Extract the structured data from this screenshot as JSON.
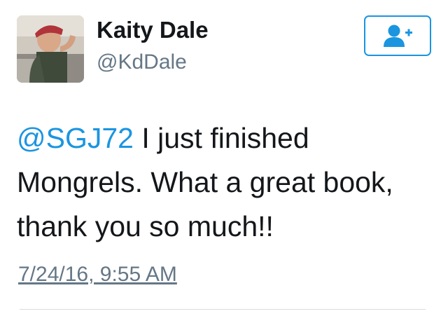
{
  "user": {
    "display_name": "Kaity Dale",
    "handle": "@KdDale",
    "avatar_icon": "profile-photo"
  },
  "follow_button": {
    "icon": "follow-user-plus-icon",
    "accent_color": "#1b95e0"
  },
  "tweet": {
    "mention": "@SGJ72",
    "text": " I just finished Mongrels. What a great book, thank you so much!!",
    "timestamp": "7/24/16, 9:55 AM"
  },
  "colors": {
    "text": "#14171a",
    "secondary": "#657786",
    "link": "#1b95e0"
  }
}
